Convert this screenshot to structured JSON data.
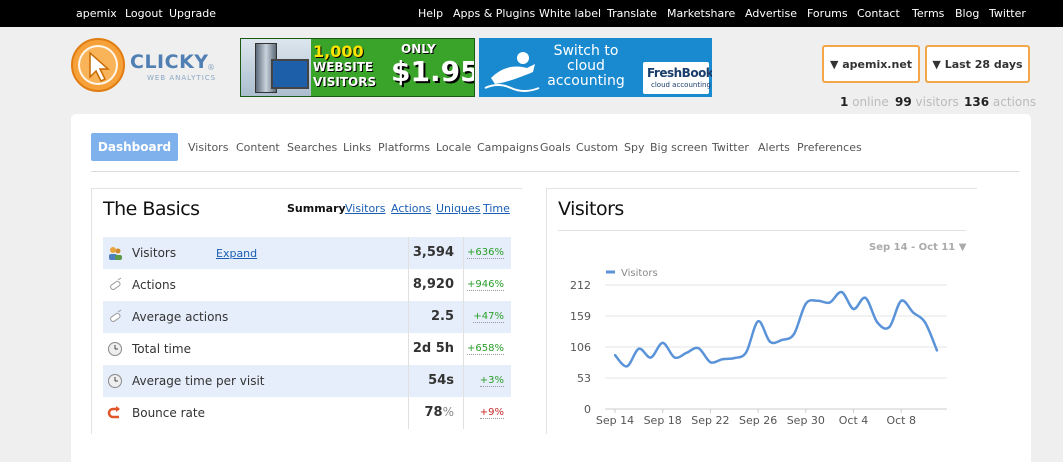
{
  "topbar": {
    "left": [
      "apemix",
      "Logout",
      "Upgrade"
    ],
    "right": [
      "Help",
      "Apps & Plugins",
      "White label",
      "Translate",
      "Marketshare",
      "Advertise",
      "Forums",
      "Contact",
      "Terms",
      "Blog",
      "Twitter"
    ]
  },
  "logo": {
    "text": "CLICKY",
    "sub": "WEB ANALYTICS",
    "reg": "®"
  },
  "ads": {
    "ad1": {
      "line1": "1,000",
      "line2": "WEBSITE",
      "line3": "VISITORS",
      "only": "ONLY",
      "price": "$1.95"
    },
    "ad2": {
      "line1": "Switch to",
      "line2": "cloud",
      "line3": "accounting",
      "brand": "FreshBooks",
      "brand_sub": "cloud accounting"
    }
  },
  "site_button": "▼ apemix.net",
  "range_button": "▼ Last 28 days",
  "stats": {
    "online_count": "1",
    "online_label": "online",
    "visitors_count": "99",
    "visitors_label": "visitors",
    "actions_count": "136",
    "actions_label": "actions"
  },
  "nav": {
    "active": "Dashboard",
    "tabs": [
      "Visitors",
      "Content",
      "Searches",
      "Links",
      "Platforms",
      "Locale",
      "Campaigns",
      "Goals",
      "Custom",
      "Spy",
      "Big screen",
      "Twitter",
      "Alerts",
      "Preferences"
    ]
  },
  "basics": {
    "title": "The Basics",
    "subnav_current": "Summary",
    "subnav_links": [
      "Visitors",
      "Actions",
      "Uniques",
      "Time"
    ],
    "expand_label": "Expand",
    "rows": [
      {
        "name": "Visitors",
        "value": "3,594",
        "unit": "",
        "change": "+636%",
        "change_color": "#2a9d2a",
        "icon": "visitors-icon"
      },
      {
        "name": "Actions",
        "value": "8,920",
        "unit": "",
        "change": "+946%",
        "change_color": "#2a9d2a",
        "icon": "actions-icon"
      },
      {
        "name": "Average actions",
        "value": "2.5",
        "unit": "",
        "change": "+47%",
        "change_color": "#2a9d2a",
        "icon": "average-actions-icon"
      },
      {
        "name": "Total time",
        "value": "2d 5h",
        "unit": "",
        "change": "+658%",
        "change_color": "#2a9d2a",
        "icon": "clock-icon"
      },
      {
        "name": "Average time per visit",
        "value": "54s",
        "unit": "",
        "change": "+3%",
        "change_color": "#2a9d2a",
        "icon": "clock-icon"
      },
      {
        "name": "Bounce rate",
        "value": "78",
        "unit": "%",
        "change": "+9%",
        "change_color": "#c62828",
        "icon": "bounce-icon"
      }
    ]
  },
  "visitors_panel": {
    "title": "Visitors",
    "range": "Sep 14 - Oct 11 ▼"
  },
  "chart_data": {
    "type": "line",
    "series": [
      {
        "name": "Visitors",
        "color": "#5b93d9",
        "values": [
          92,
          73,
          103,
          88,
          113,
          88,
          96,
          104,
          80,
          85,
          87,
          97,
          150,
          115,
          118,
          128,
          180,
          185,
          182,
          200,
          171,
          190,
          148,
          140,
          185,
          165,
          148,
          100
        ]
      }
    ],
    "x_tick_labels": [
      "Sep 14",
      "Sep 18",
      "Sep 22",
      "Sep 26",
      "Sep 30",
      "Oct 4",
      "Oct 8"
    ],
    "y_tick_labels": [
      "0",
      "53",
      "106",
      "159",
      "212"
    ],
    "ylim": [
      0,
      212
    ],
    "grid": true,
    "legend": "top-left"
  }
}
